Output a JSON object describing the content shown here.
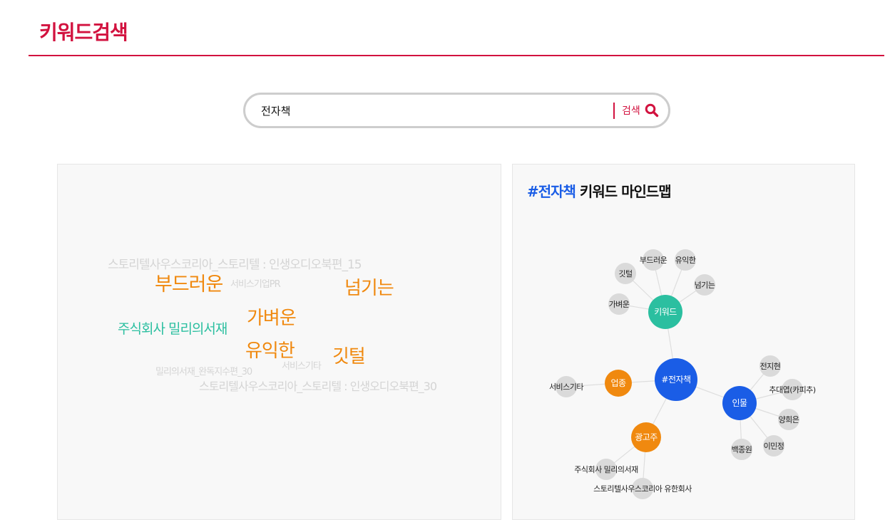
{
  "header": {
    "title": "키워드검색"
  },
  "search": {
    "value": "전자책",
    "button_label": "검색"
  },
  "word_cloud": {
    "words": [
      {
        "text": "스토리텔사우스코리아_스토리텔 : 인생오디오북편_15",
        "color": "#d4d4d4"
      },
      {
        "text": "부드러운",
        "color": "#f0890f"
      },
      {
        "text": "서비스기업PR",
        "color": "#d4d4d4"
      },
      {
        "text": "넘기는",
        "color": "#f0890f"
      },
      {
        "text": "가벼운",
        "color": "#f0890f"
      },
      {
        "text": "주식회사 밀리의서재",
        "color": "#2bbfa0"
      },
      {
        "text": "유익한",
        "color": "#f0890f"
      },
      {
        "text": "깃털",
        "color": "#f0890f"
      },
      {
        "text": "서비스기타",
        "color": "#d4d4d4"
      },
      {
        "text": "밀리의서재_완독지수편_30",
        "color": "#d4d4d4"
      },
      {
        "text": "스토리텔사우스코리아_스토리텔 : 인생오디오북편_30",
        "color": "#d4d4d4"
      }
    ]
  },
  "mindmap": {
    "title_hashtag": "#전자책",
    "title_text": " 키워드 마인드맵",
    "colors": {
      "center": "#1a5de6",
      "keyword": "#2bbfa0",
      "industry": "#f0890f",
      "person": "#1a5de6",
      "leaf": "#dadada"
    },
    "center": "#전자책",
    "hubs": {
      "keyword": "키워드",
      "industry": "업종",
      "advertiser": "광고주",
      "person": "인물"
    },
    "leaves": {
      "keyword": [
        "부드러운",
        "유익한",
        "깃털",
        "넘기는",
        "가벼운"
      ],
      "industry": [
        "서비스기타"
      ],
      "advertiser": [
        "주식회사 밀리의서재",
        "스토리텔사우스코리아 유한회사"
      ],
      "person": [
        "전지현",
        "추대엽(카피추)",
        "양희은",
        "이민정",
        "백종원"
      ]
    }
  }
}
